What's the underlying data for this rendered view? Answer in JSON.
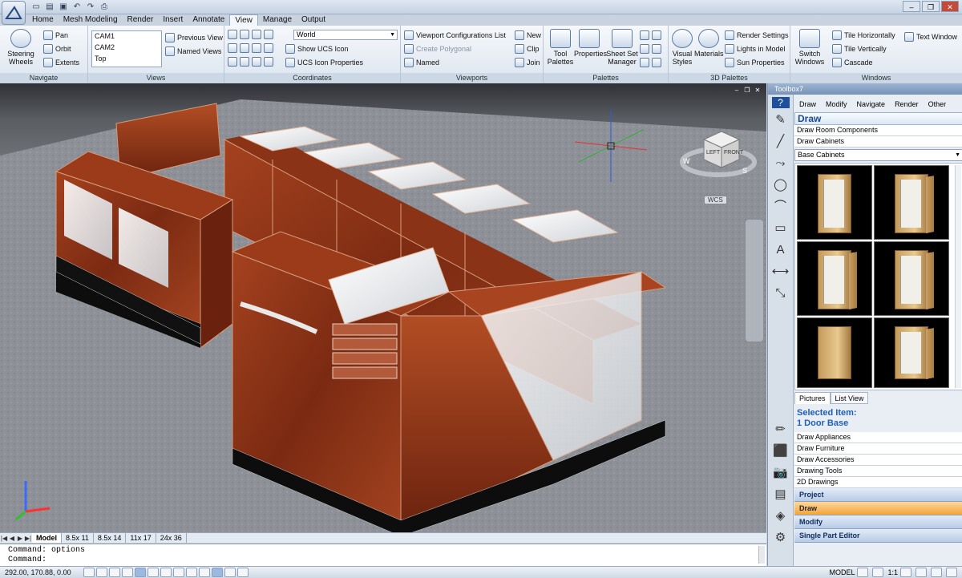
{
  "tabs": [
    "Home",
    "Mesh Modeling",
    "Render",
    "Insert",
    "Annotate",
    "View",
    "Manage",
    "Output"
  ],
  "active_tab": "View",
  "ribbon": {
    "navigate": {
      "title": "Navigate",
      "steering": "Steering Wheels",
      "pan": "Pan",
      "orbit": "Orbit",
      "extents": "Extents"
    },
    "views": {
      "title": "Views",
      "list": [
        "CAM1",
        "CAM2",
        "Top"
      ],
      "previous": "Previous View",
      "named": "Named Views"
    },
    "coordinates": {
      "title": "Coordinates",
      "ucs": "World",
      "show_ucs": "Show UCS Icon",
      "ucs_props": "UCS Icon Properties"
    },
    "viewports": {
      "title": "Viewports",
      "config": "Viewport Configurations List",
      "create_poly": "Create Polygonal",
      "named": "Named",
      "new": "New",
      "clip": "Clip",
      "join": "Join"
    },
    "palettes": {
      "title": "Palettes",
      "tool": "Tool Palettes",
      "properties": "Properties",
      "sheetset": "Sheet Set Manager"
    },
    "palettes3d": {
      "title": "3D Palettes",
      "visual": "Visual Styles",
      "materials": "Materials",
      "render_settings": "Render Settings",
      "lights": "Lights in Model",
      "sun": "Sun Properties"
    },
    "windows": {
      "title": "Windows",
      "switch": "Switch Windows",
      "tile_h": "Tile Horizontally",
      "tile_v": "Tile Vertically",
      "cascade": "Cascade",
      "text_window": "Text Window"
    }
  },
  "viewport": {
    "wcs": "WCS",
    "cube_left": "LEFT",
    "cube_front": "FRONT",
    "compass_w": "W",
    "compass_s": "S"
  },
  "layout_tabs": [
    "Model",
    "8.5x 11",
    "8.5x 14",
    "11x 17",
    "24x 36"
  ],
  "command_lines": [
    "Command: options",
    "Command:"
  ],
  "status": {
    "coords": "292.00, 170.88, 0.00",
    "model": "MODEL",
    "scale": "1:1"
  },
  "toolbox": {
    "title": "Toolbox7",
    "menu": [
      "Draw",
      "Modify",
      "Navigate",
      "Render",
      "Other"
    ],
    "header": "Draw",
    "links": [
      "Draw Room Components",
      "Draw Cabinets"
    ],
    "category": "Base Cabinets",
    "view_tabs": [
      "Pictures",
      "List View"
    ],
    "selected_label": "Selected Item:",
    "selected_value": "1 Door Base",
    "links2": [
      "Draw Appliances",
      "Draw Furniture",
      "Draw Accessories",
      "Drawing Tools",
      "2D Drawings"
    ],
    "sections": [
      "Project",
      "Draw",
      "Modify",
      "Single Part Editor"
    ],
    "active_section": "Draw"
  },
  "colors": {
    "ribbon_bg": "#dce5ef",
    "accent": "#1f5fb8",
    "active_section": "#f2a43b",
    "wood": "#8b2f16"
  }
}
